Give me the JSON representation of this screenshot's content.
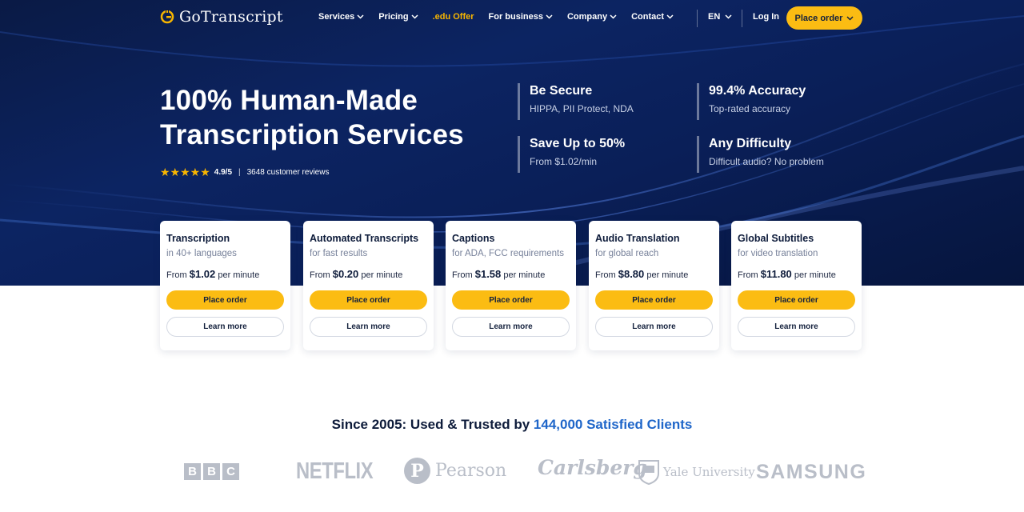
{
  "nav": {
    "brand": "GoTranscript",
    "items": [
      {
        "label": "Services",
        "dropdown": true
      },
      {
        "label": "Pricing",
        "dropdown": true
      },
      {
        "label": ".edu Offer",
        "dropdown": false
      },
      {
        "label": "For business",
        "dropdown": true
      },
      {
        "label": "Company",
        "dropdown": true
      },
      {
        "label": "Contact",
        "dropdown": true
      }
    ],
    "language": "EN",
    "login": "Log In",
    "order": "Place order"
  },
  "hero": {
    "headline_line1": "100% Human-Made",
    "headline_line2": "Transcription Services",
    "rating": {
      "stars": 5,
      "score": "4.9/5",
      "separator": "|",
      "reviews": "3648 customer reviews"
    },
    "features": [
      {
        "title": "Be Secure",
        "subtitle": "HIPPA, PII Protect, NDA"
      },
      {
        "title": "99.4% Accuracy",
        "subtitle": "Top-rated accuracy"
      },
      {
        "title": "Save Up to 50%",
        "subtitle": "From $1.02/min"
      },
      {
        "title": "Any Difficulty",
        "subtitle": "Difficult audio? No problem"
      }
    ]
  },
  "cards": [
    {
      "title": "Transcription",
      "subtitle": "in 40+ languages",
      "from": "From",
      "price": "$1.02",
      "unit": "per minute",
      "order": "Place order",
      "learn": "Learn more"
    },
    {
      "title": "Automated Transcripts",
      "subtitle": "for fast results",
      "from": "From",
      "price": "$0.20",
      "unit": "per minute",
      "order": "Place order",
      "learn": "Learn more"
    },
    {
      "title": "Captions",
      "subtitle": "for ADA, FCC requirements",
      "from": "From",
      "price": "$1.58",
      "unit": "per minute",
      "order": "Place order",
      "learn": "Learn more"
    },
    {
      "title": "Audio Translation",
      "subtitle": "for global reach",
      "from": "From",
      "price": "$8.80",
      "unit": "per minute",
      "order": "Place order",
      "learn": "Learn more"
    },
    {
      "title": "Global Subtitles",
      "subtitle": "for video translation",
      "from": "From",
      "price": "$11.80",
      "unit": "per minute",
      "order": "Place order",
      "learn": "Learn more"
    }
  ],
  "trusted": {
    "prefix": "Since 2005: Used & Trusted by ",
    "highlight": "144,000 Satisfied Clients"
  },
  "client_logos": [
    "BBC",
    "NETFLIX",
    "Pearson",
    "Carlsberg",
    "Yale University",
    "SAMSUNG"
  ],
  "colors": {
    "accent": "#fbbc13",
    "hero_bg": "#0c2462",
    "link_blue": "#1f66c9",
    "edu": "#f7b500"
  }
}
